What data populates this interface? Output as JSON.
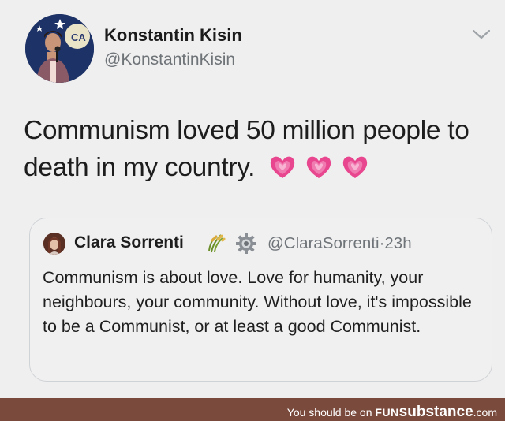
{
  "tweet": {
    "author": {
      "display_name": "Konstantin Kisin",
      "handle": "@KonstantinKisin",
      "avatar_icon": "profile-photo-comedian-with-microphone"
    },
    "menu_icon": "chevron-down-icon",
    "text": "Communism loved 50 million people to death in my country.",
    "emoji": [
      "growing-heart",
      "growing-heart",
      "growing-heart"
    ]
  },
  "quoted_tweet": {
    "author": {
      "display_name": "Clara Sorrenti",
      "emoji": [
        "sheaf-of-rice",
        "gear"
      ],
      "handle": "@ClaraSorrenti",
      "separator": "·",
      "time": "23h"
    },
    "text": "Communism is about love. Love for humanity, your neighbours, your community. Without love, it's impossible to be a Communist, or at least a good Communist."
  },
  "watermark": {
    "prefix": "You should be on ",
    "brand_fun": "FUN",
    "brand_rest": "substance",
    "suffix": ".com"
  },
  "colors": {
    "background": "#efefef",
    "text": "#1d1d1d",
    "muted": "#6f7479",
    "heart_pink": "#e8478f",
    "footer_bar": "#7a4b3d"
  }
}
